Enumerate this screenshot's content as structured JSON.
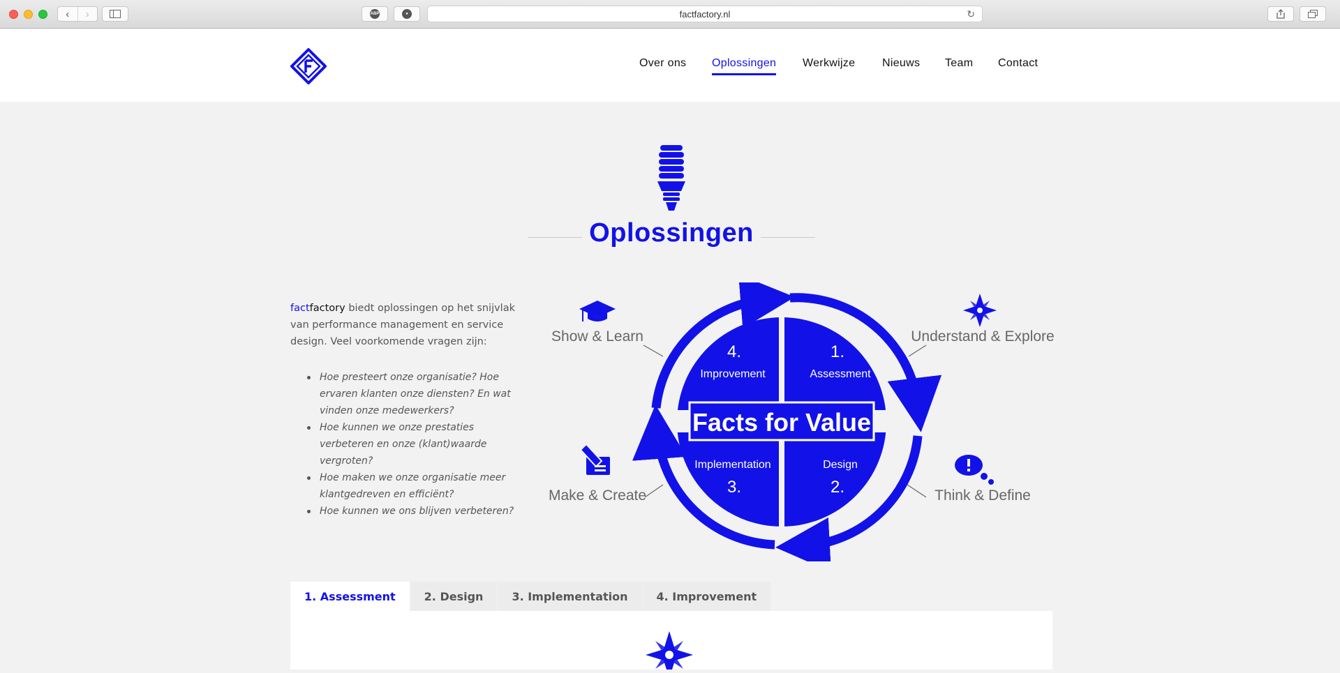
{
  "browser": {
    "url": "factfactory.nl",
    "ext1": "ABP"
  },
  "nav": {
    "items": [
      {
        "label": "Over ons"
      },
      {
        "label": "Oplossingen",
        "active": true
      },
      {
        "label": "Werkwijze"
      },
      {
        "label": "Nieuws"
      },
      {
        "label": "Team"
      },
      {
        "label": "Contact"
      }
    ]
  },
  "main": {
    "title": "Oplossingen",
    "intro_brand_a": "fact",
    "intro_brand_b": "factory",
    "intro_text": " biedt oplossingen op het snijvlak van performance management en service design. Veel voorkomende vragen zijn:",
    "questions": [
      "Hoe presteert onze organisatie? Hoe ervaren klanten onze diensten? En wat vinden onze medewerkers?",
      "Hoe kunnen we onze prestaties verbeteren en onze (klant)waarde vergroten?",
      "Hoe maken we onze organisatie meer klantgedreven en efficiënt?",
      "Hoe kunnen we ons blijven verbeteren?"
    ]
  },
  "diagram": {
    "center": "Facts for Value",
    "quadrants": {
      "q1": {
        "num": "1.",
        "label": "Assessment"
      },
      "q2": {
        "num": "2.",
        "label": "Design"
      },
      "q3": {
        "num": "3.",
        "label": "Implementation"
      },
      "q4": {
        "num": "4.",
        "label": "Improvement"
      }
    },
    "phases": {
      "top_right": "Understand & Explore",
      "bottom_right": "Think & Define",
      "bottom_left": "Make & Create",
      "top_left": "Show & Learn"
    }
  },
  "tabs": [
    {
      "label": "1. Assessment",
      "active": true
    },
    {
      "label": "2. Design"
    },
    {
      "label": "3. Implementation"
    },
    {
      "label": "4. Improvement"
    }
  ],
  "colors": {
    "accent": "#1212e8"
  },
  "icons": [
    "lightbulb-icon",
    "graduation-cap-icon",
    "compass-icon",
    "thought-bubble-icon",
    "pencil-paper-icon",
    "logo-f-diamond"
  ]
}
